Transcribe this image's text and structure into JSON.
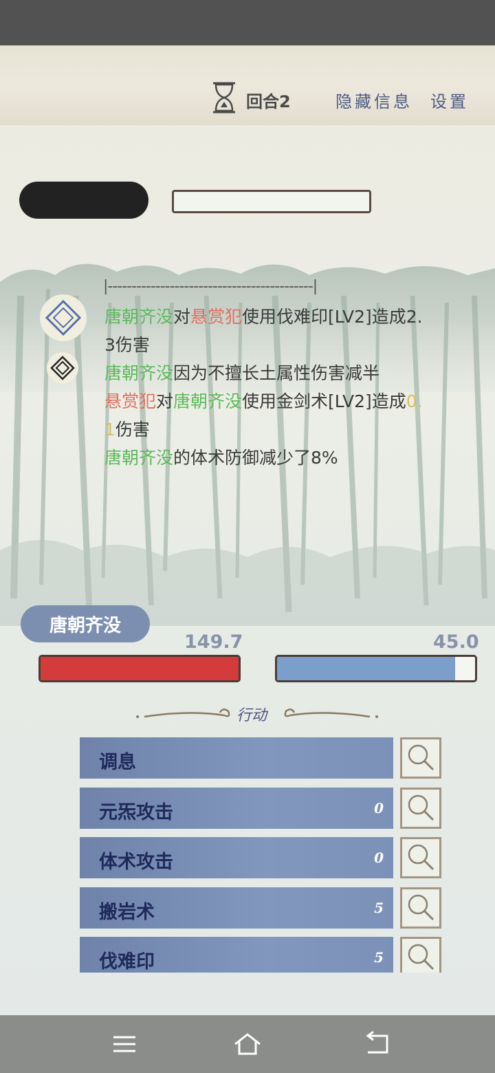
{
  "header": {
    "round_label": "回合2",
    "hide_info_label": "隐藏信息",
    "settings_label": "设置"
  },
  "battle_log": {
    "divider": "|-------------------------------------------|",
    "lines": [
      {
        "segments": [
          {
            "text": "唐朝齐没",
            "style": "g"
          },
          {
            "text": "对",
            "style": ""
          },
          {
            "text": "悬赏犯",
            "style": "r"
          },
          {
            "text": "使用伐难印[LV2]造成2.",
            "style": ""
          }
        ]
      },
      {
        "segments": [
          {
            "text": "3伤害",
            "style": ""
          }
        ]
      },
      {
        "segments": [
          {
            "text": "唐朝齐没",
            "style": "g"
          },
          {
            "text": "因为不擅长土属性伤害减半",
            "style": ""
          }
        ]
      },
      {
        "segments": [
          {
            "text": "悬赏犯",
            "style": "r"
          },
          {
            "text": "对",
            "style": ""
          },
          {
            "text": "唐朝齐没",
            "style": "g"
          },
          {
            "text": "使用金剑术[LV2]造成",
            "style": ""
          },
          {
            "text": "0.",
            "style": "y"
          }
        ]
      },
      {
        "segments": [
          {
            "text": "1",
            "style": "y"
          },
          {
            "text": "伤害",
            "style": ""
          }
        ]
      },
      {
        "segments": [
          {
            "text": "唐朝齐没",
            "style": "g"
          },
          {
            "text": "的体术防御减少了8%",
            "style": ""
          }
        ]
      }
    ]
  },
  "player": {
    "name": "唐朝齐没",
    "hp_value": "149.7",
    "hp_fill_fraction": 1.0,
    "mp_value": "45.0",
    "mp_fill_fraction": 0.9
  },
  "actions": {
    "header": "行动",
    "items": [
      {
        "label": "调息",
        "cost": ""
      },
      {
        "label": "元炁攻击",
        "cost": "0"
      },
      {
        "label": "体术攻击",
        "cost": "0"
      },
      {
        "label": "搬岩术",
        "cost": "5"
      },
      {
        "label": "伐难印",
        "cost": "5"
      }
    ]
  },
  "colors": {
    "hp": "#d33c3a",
    "mp": "#7b9ecb",
    "friendly_name": "#5cba5a",
    "enemy_name": "#e07060",
    "damage_highlight": "#d8c060"
  },
  "icons": {
    "round": "hourglass-icon",
    "log_skill_1": "diamond-icon",
    "log_skill_2": "diamond-icon",
    "inspect": "magnifier-icon",
    "nav_menu": "menu-icon",
    "nav_home": "home-icon",
    "nav_back": "back-icon"
  }
}
